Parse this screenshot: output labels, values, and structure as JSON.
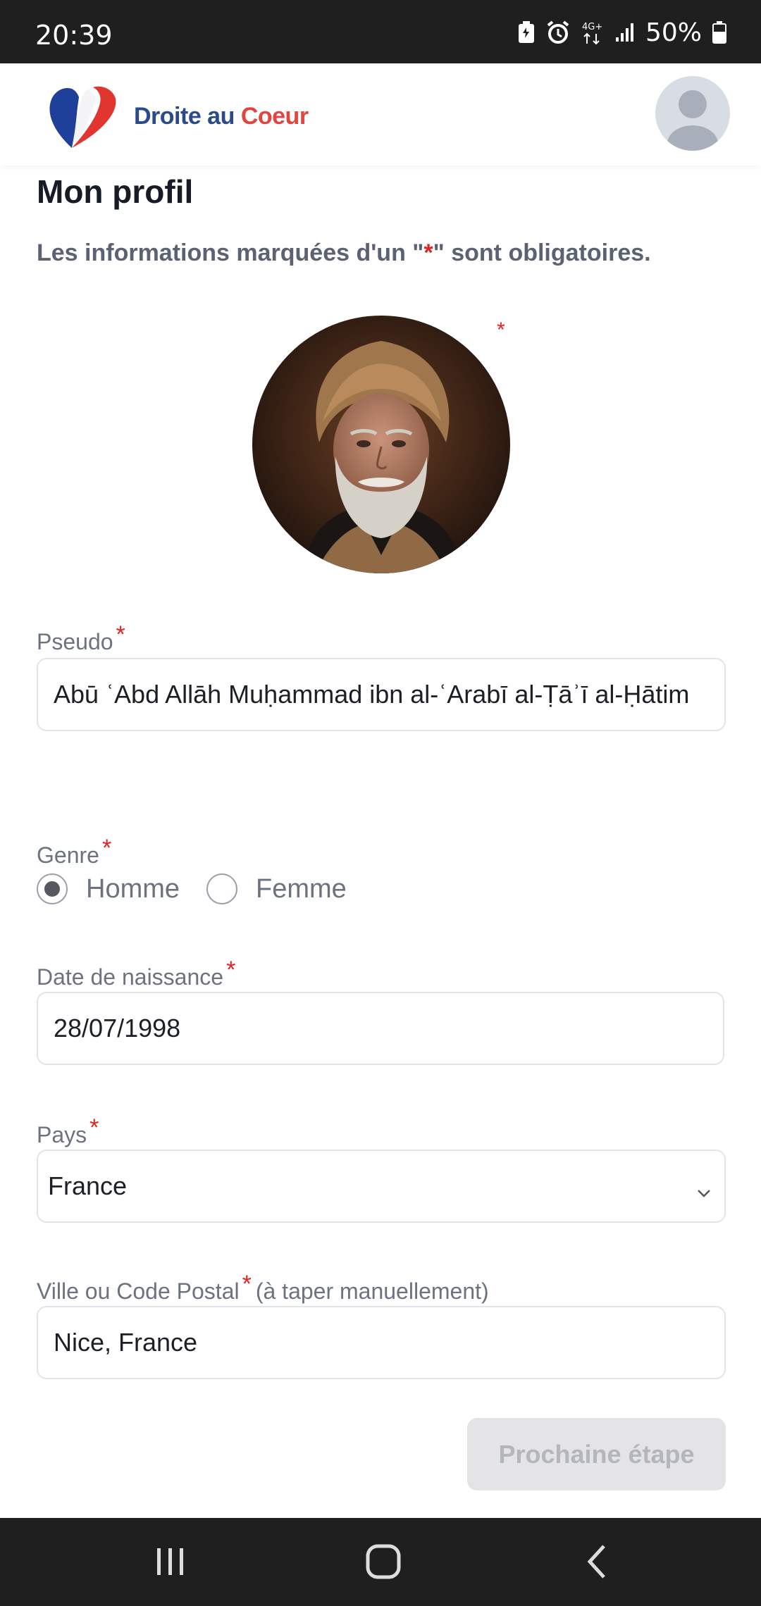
{
  "status_bar": {
    "time": "20:39",
    "battery_percent": "50%",
    "network": "4G+",
    "icons": [
      "battery-saver-icon",
      "alarm-icon",
      "4g-data-icon",
      "signal-icon",
      "battery-icon"
    ]
  },
  "header": {
    "brand_part1": "Droite au ",
    "brand_part2": "Coeur",
    "colors": {
      "brand_blue": "#2b4a8a",
      "brand_red": "#e0463f"
    }
  },
  "page": {
    "title": "Mon profil",
    "note_prefix": "Les informations marquées d'un \"",
    "note_star": "*",
    "note_suffix": "\" sont obligatoires."
  },
  "form": {
    "photo_required": "*",
    "pseudo": {
      "label": "Pseudo",
      "required": "*",
      "value": "Abū ʿAbd Allāh Muḥammad ibn al-ʿArabī al-Ṭāʾī al-Ḥātim"
    },
    "genre": {
      "label": "Genre",
      "required": "*",
      "options": [
        {
          "label": "Homme",
          "selected": true
        },
        {
          "label": "Femme",
          "selected": false
        }
      ]
    },
    "birthdate": {
      "label": "Date de naissance",
      "required": "*",
      "value": "28/07/1998"
    },
    "country": {
      "label": "Pays",
      "required": "*",
      "value": "France"
    },
    "city": {
      "label": "Ville ou Code Postal",
      "required": "*",
      "hint": "(à taper manuellement)",
      "value": "Nice, France"
    },
    "next_button": "Prochaine étape"
  },
  "nav_bar": {
    "icons": [
      "recent-apps-icon",
      "home-icon",
      "back-icon"
    ]
  }
}
